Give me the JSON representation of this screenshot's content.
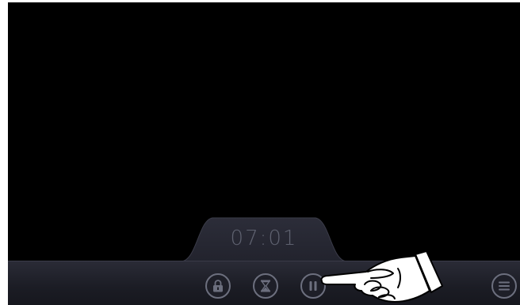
{
  "player": {
    "elapsed_time": "07:01"
  },
  "controls": [
    {
      "name": "lock-button",
      "icon": "lock-icon"
    },
    {
      "name": "timer-button",
      "icon": "hourglass-icon"
    },
    {
      "name": "pause-button",
      "icon": "pause-icon"
    },
    {
      "name": "menu-button",
      "icon": "menu-icon"
    }
  ],
  "colors": {
    "background": "#000000",
    "bar": "#1e1f28",
    "icon": "#6c6f7e",
    "time_text": "#5f6270"
  }
}
